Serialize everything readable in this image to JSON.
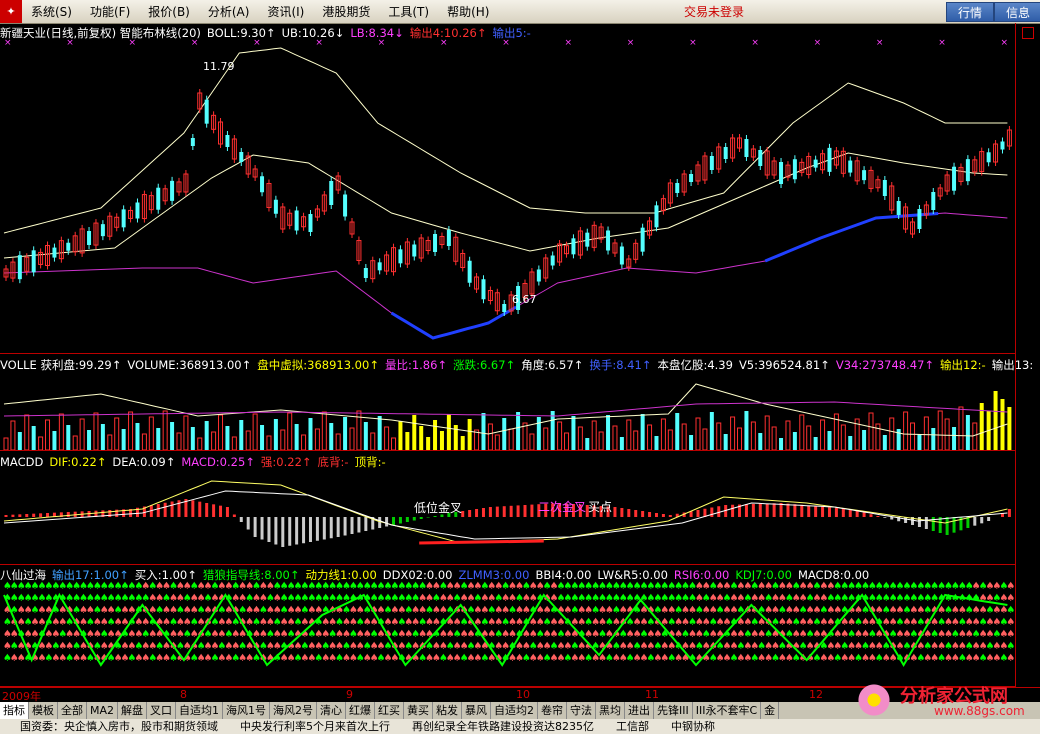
{
  "menu": {
    "items": [
      "系统(S)",
      "功能(F)",
      "报价(B)",
      "分析(A)",
      "资讯(I)",
      "港股期货",
      "工具(T)",
      "帮助(H)"
    ],
    "status": "交易未登录",
    "quote_btn": "行情",
    "info_btn": "信息"
  },
  "main": {
    "items": [
      {
        "t": "新疆天业(日线,前复权) 智能布林线(20)",
        "c": "#ffffff"
      },
      {
        "t": "BOLL:9.30↑",
        "c": "#ffffff"
      },
      {
        "t": "UB:10.26↓",
        "c": "#ffffff"
      },
      {
        "t": "LB:8.34↓",
        "c": "#ff40ff"
      },
      {
        "t": "输出4:10.26↑",
        "c": "#ff3030"
      },
      {
        "t": "输出5:-",
        "c": "#4060ff"
      }
    ],
    "high_label": "11.79",
    "low_label": "6.67"
  },
  "vol": {
    "items": [
      {
        "t": "VOLLE 获利盘:99.29↑",
        "c": "#ffffff"
      },
      {
        "t": "VOLUME:368913.00↑",
        "c": "#ffffff"
      },
      {
        "t": "盘中虚拟:368913.00↑",
        "c": "#ffff00"
      },
      {
        "t": "量比:1.86↑",
        "c": "#ff40ff"
      },
      {
        "t": "涨跌:6.67↑",
        "c": "#00ff00"
      },
      {
        "t": "角度:6.57↑",
        "c": "#ffffff"
      },
      {
        "t": "换手:8.41↑",
        "c": "#4060ff"
      },
      {
        "t": "本盘亿股:4.39",
        "c": "#ffffff"
      },
      {
        "t": "V5:396524.81↑",
        "c": "#ffffff"
      },
      {
        "t": "V34:273748.47↑",
        "c": "#ff40ff"
      },
      {
        "t": "输出12:-",
        "c": "#ffff00"
      },
      {
        "t": "输出13:",
        "c": "#ffffff"
      }
    ]
  },
  "macd": {
    "items": [
      {
        "t": "MACDD",
        "c": "#ffffff"
      },
      {
        "t": "DIF:0.22↑",
        "c": "#ffff00"
      },
      {
        "t": "DEA:0.09↑",
        "c": "#ffffff"
      },
      {
        "t": "MACD:0.25↑",
        "c": "#ff40ff"
      },
      {
        "t": "强:0.22↑",
        "c": "#ff3030"
      },
      {
        "t": "底背:-",
        "c": "#ff3030"
      },
      {
        "t": "顶背:-",
        "c": "#ffff00"
      }
    ],
    "label_low": "低位金叉",
    "label_double": "二次金叉",
    "label_cross": "买点"
  },
  "bx": {
    "items": [
      {
        "t": "八仙过海",
        "c": "#ffffff"
      },
      {
        "t": "输出17:1.00↑",
        "c": "#40a0ff"
      },
      {
        "t": "买入:1.00↑",
        "c": "#ffffff"
      },
      {
        "t": "猎狼指导线:8.00↑",
        "c": "#00ff00"
      },
      {
        "t": "动力线1:0.00",
        "c": "#ffff00"
      },
      {
        "t": "DDX02:0.00",
        "c": "#ffffff"
      },
      {
        "t": "ZLMM3:0.00",
        "c": "#4060ff"
      },
      {
        "t": "BBI4:0.00",
        "c": "#ffffff"
      },
      {
        "t": "LW&R5:0.00",
        "c": "#ffffff"
      },
      {
        "t": "RSI6:0.00",
        "c": "#ff40ff"
      },
      {
        "t": "KDJ7:0.00",
        "c": "#00ff00"
      },
      {
        "t": "MACD8:0.00",
        "c": "#ffffff"
      }
    ]
  },
  "timeaxis": {
    "labels": [
      "2009年",
      "8",
      "9",
      "10",
      "11",
      "12"
    ]
  },
  "tabs": [
    "指标",
    "模板",
    "全部",
    "MA2",
    "解盘",
    "叉口",
    "自适均1",
    "海风1号",
    "海风2号",
    "清心",
    "红爆",
    "红买",
    "黄买",
    "粘发",
    "暴风",
    "自适均2",
    "卷帘",
    "守法",
    "黑均",
    "进出",
    "先锋III",
    "III永不套牢C",
    "金"
  ],
  "ticker": [
    "国资委：央企慎入房市，股市和期货领域",
    "中央发行利率5个月来首次上行",
    "再创纪录全年铁路建设投资达8235亿",
    "工信部",
    "中钢协称"
  ],
  "watermark": {
    "brand": "分析家公式网",
    "url": "www.88gs.com"
  },
  "colors": {
    "up": "#ff3030",
    "down": "#54ffff",
    "ma": "#ffffcc",
    "lb": "#cc33cc",
    "panel_border": "#b00000"
  }
}
